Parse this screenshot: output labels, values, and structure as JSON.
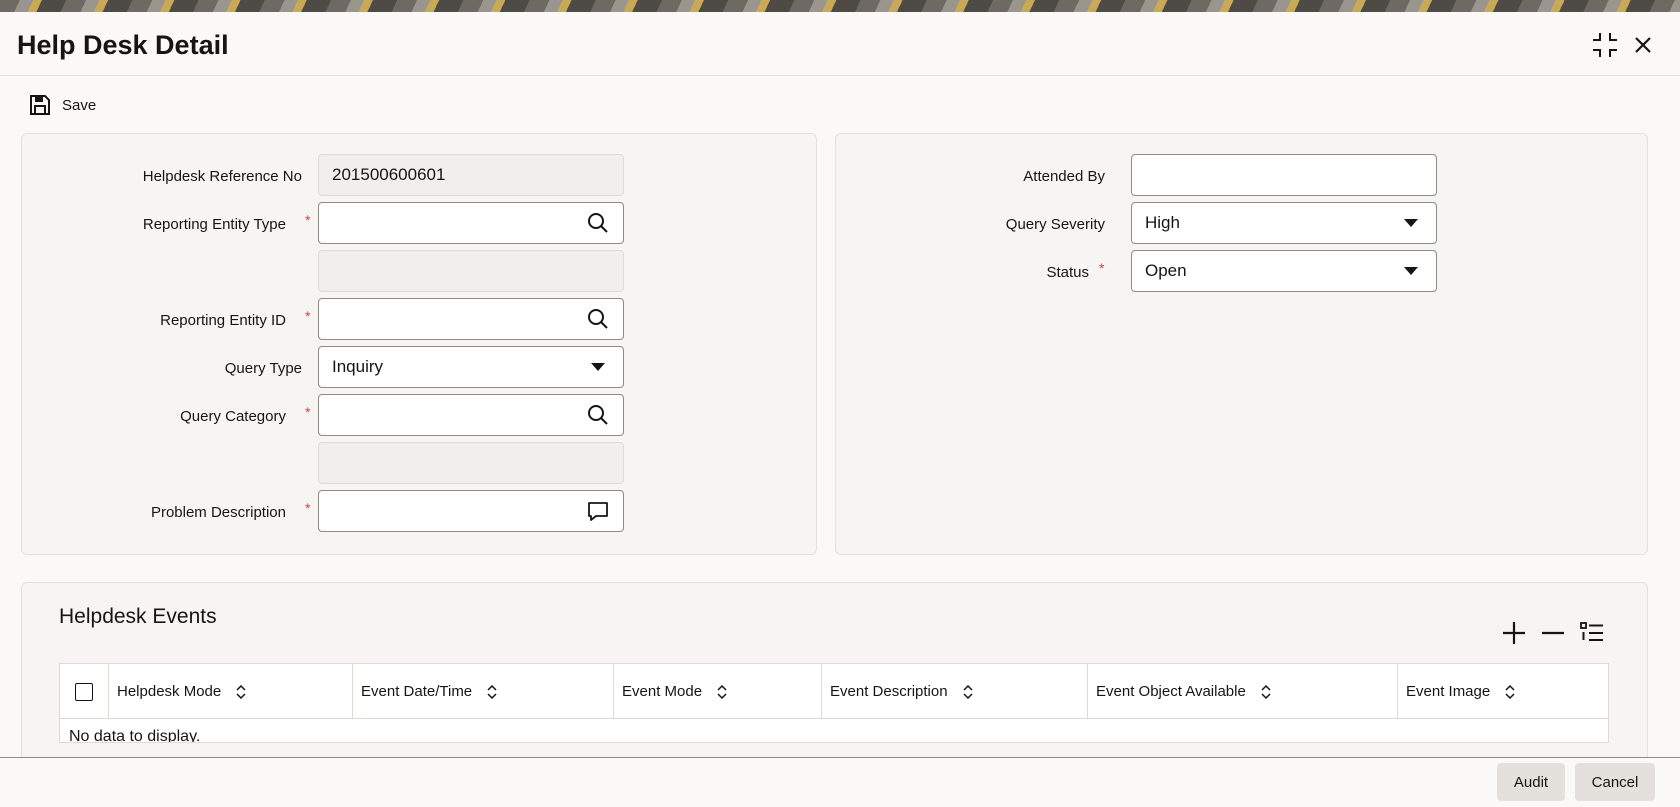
{
  "window": {
    "title": "Help Desk Detail"
  },
  "toolbar": {
    "save_label": "Save"
  },
  "left_panel": {
    "helpdesk_reference_no": {
      "label": "Helpdesk Reference No",
      "value": "201500600601"
    },
    "reporting_entity_type": {
      "label": "Reporting Entity Type",
      "value": "",
      "required": "*"
    },
    "reporting_entity_type_desc": {
      "value": ""
    },
    "reporting_entity_id": {
      "label": "Reporting Entity ID",
      "value": "",
      "required": "*"
    },
    "query_type": {
      "label": "Query Type",
      "value": "Inquiry"
    },
    "query_category": {
      "label": "Query Category",
      "value": "",
      "required": "*"
    },
    "query_category_desc": {
      "value": ""
    },
    "problem_description": {
      "label": "Problem Description",
      "value": "",
      "required": "*"
    }
  },
  "right_panel": {
    "attended_by": {
      "label": "Attended By",
      "value": ""
    },
    "query_severity": {
      "label": "Query Severity",
      "value": "High"
    },
    "status": {
      "label": "Status",
      "value": "Open",
      "required": "*"
    }
  },
  "events": {
    "title": "Helpdesk Events",
    "columns": [
      "Helpdesk Mode",
      "Event Date/Time",
      "Event Mode",
      "Event Description",
      "Event Object Available",
      "Event Image"
    ],
    "empty_text": "No data to display."
  },
  "footer": {
    "audit_label": "Audit",
    "cancel_label": "Cancel"
  },
  "colors": {
    "required": "#c74634",
    "panel_bg": "#f6f5f3",
    "button_bg": "#e4e1dc"
  }
}
